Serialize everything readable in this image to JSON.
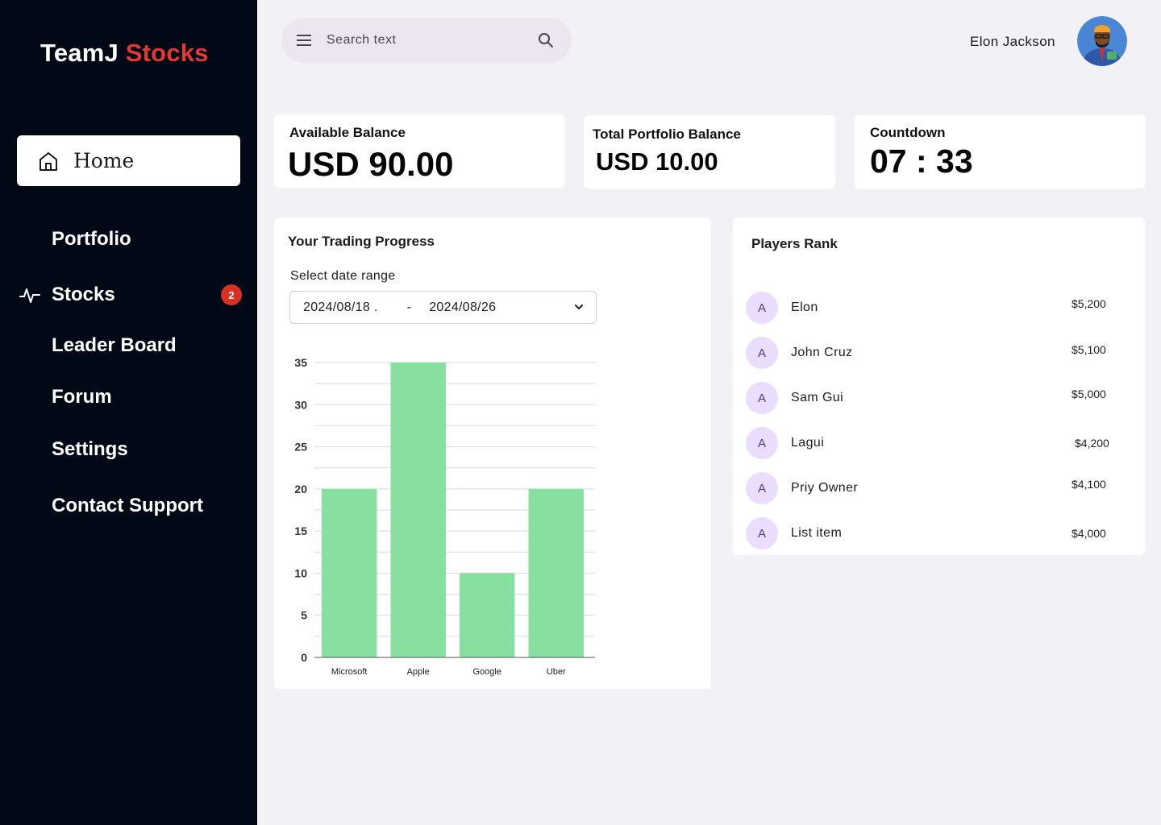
{
  "brand": {
    "name": "TeamJ",
    "accent": "Stocks"
  },
  "sidebar": {
    "home_label": "Home",
    "items": [
      {
        "label": "Portfolio"
      },
      {
        "label": "Stocks",
        "badge": "2"
      },
      {
        "label": "Leader Board"
      },
      {
        "label": "Forum"
      },
      {
        "label": "Settings"
      },
      {
        "label": "Contact Support"
      }
    ]
  },
  "header": {
    "search_placeholder": "Search text",
    "user_name": "Elon Jackson"
  },
  "stats": {
    "available": {
      "title": "Available Balance",
      "value": "USD 90.00"
    },
    "portfolio": {
      "title": "Total Portfolio Balance",
      "value": "USD 10.00"
    },
    "countdown": {
      "title": "Countdown",
      "value": "07 : 33"
    }
  },
  "trading": {
    "title": "Your Trading Progress",
    "range_label": "Select date range",
    "date_start": "2024/08/18 .",
    "date_sep": "-",
    "date_end": "2024/08/26"
  },
  "chart_data": {
    "type": "bar",
    "categories": [
      "Microsoft",
      "Apple",
      "Google",
      "Uber"
    ],
    "values": [
      20,
      35,
      10,
      20
    ],
    "ylim": [
      0,
      35
    ],
    "yticks": [
      0,
      5,
      10,
      15,
      20,
      25,
      30,
      35
    ],
    "grid": true,
    "bar_color": "#88e0a0"
  },
  "rank": {
    "title": "Players Rank",
    "players": [
      {
        "initial": "A",
        "name": "Elon",
        "amount": "$5,200"
      },
      {
        "initial": "A",
        "name": "John Cruz",
        "amount": "$5,100"
      },
      {
        "initial": "A",
        "name": "Sam Gui",
        "amount": "$5,000"
      },
      {
        "initial": "A",
        "name": "Lagui",
        "amount": "$4,200"
      },
      {
        "initial": "A",
        "name": "Priy Owner",
        "amount": "$4,100"
      },
      {
        "initial": "A",
        "name": "List item",
        "amount": "$4,000"
      }
    ]
  },
  "colors": {
    "sidebar_bg": "#020916",
    "brand_accent": "#e23a32",
    "badge": "#d93025",
    "bar": "#88e0a0",
    "page_bg": "#f2f1f6"
  }
}
